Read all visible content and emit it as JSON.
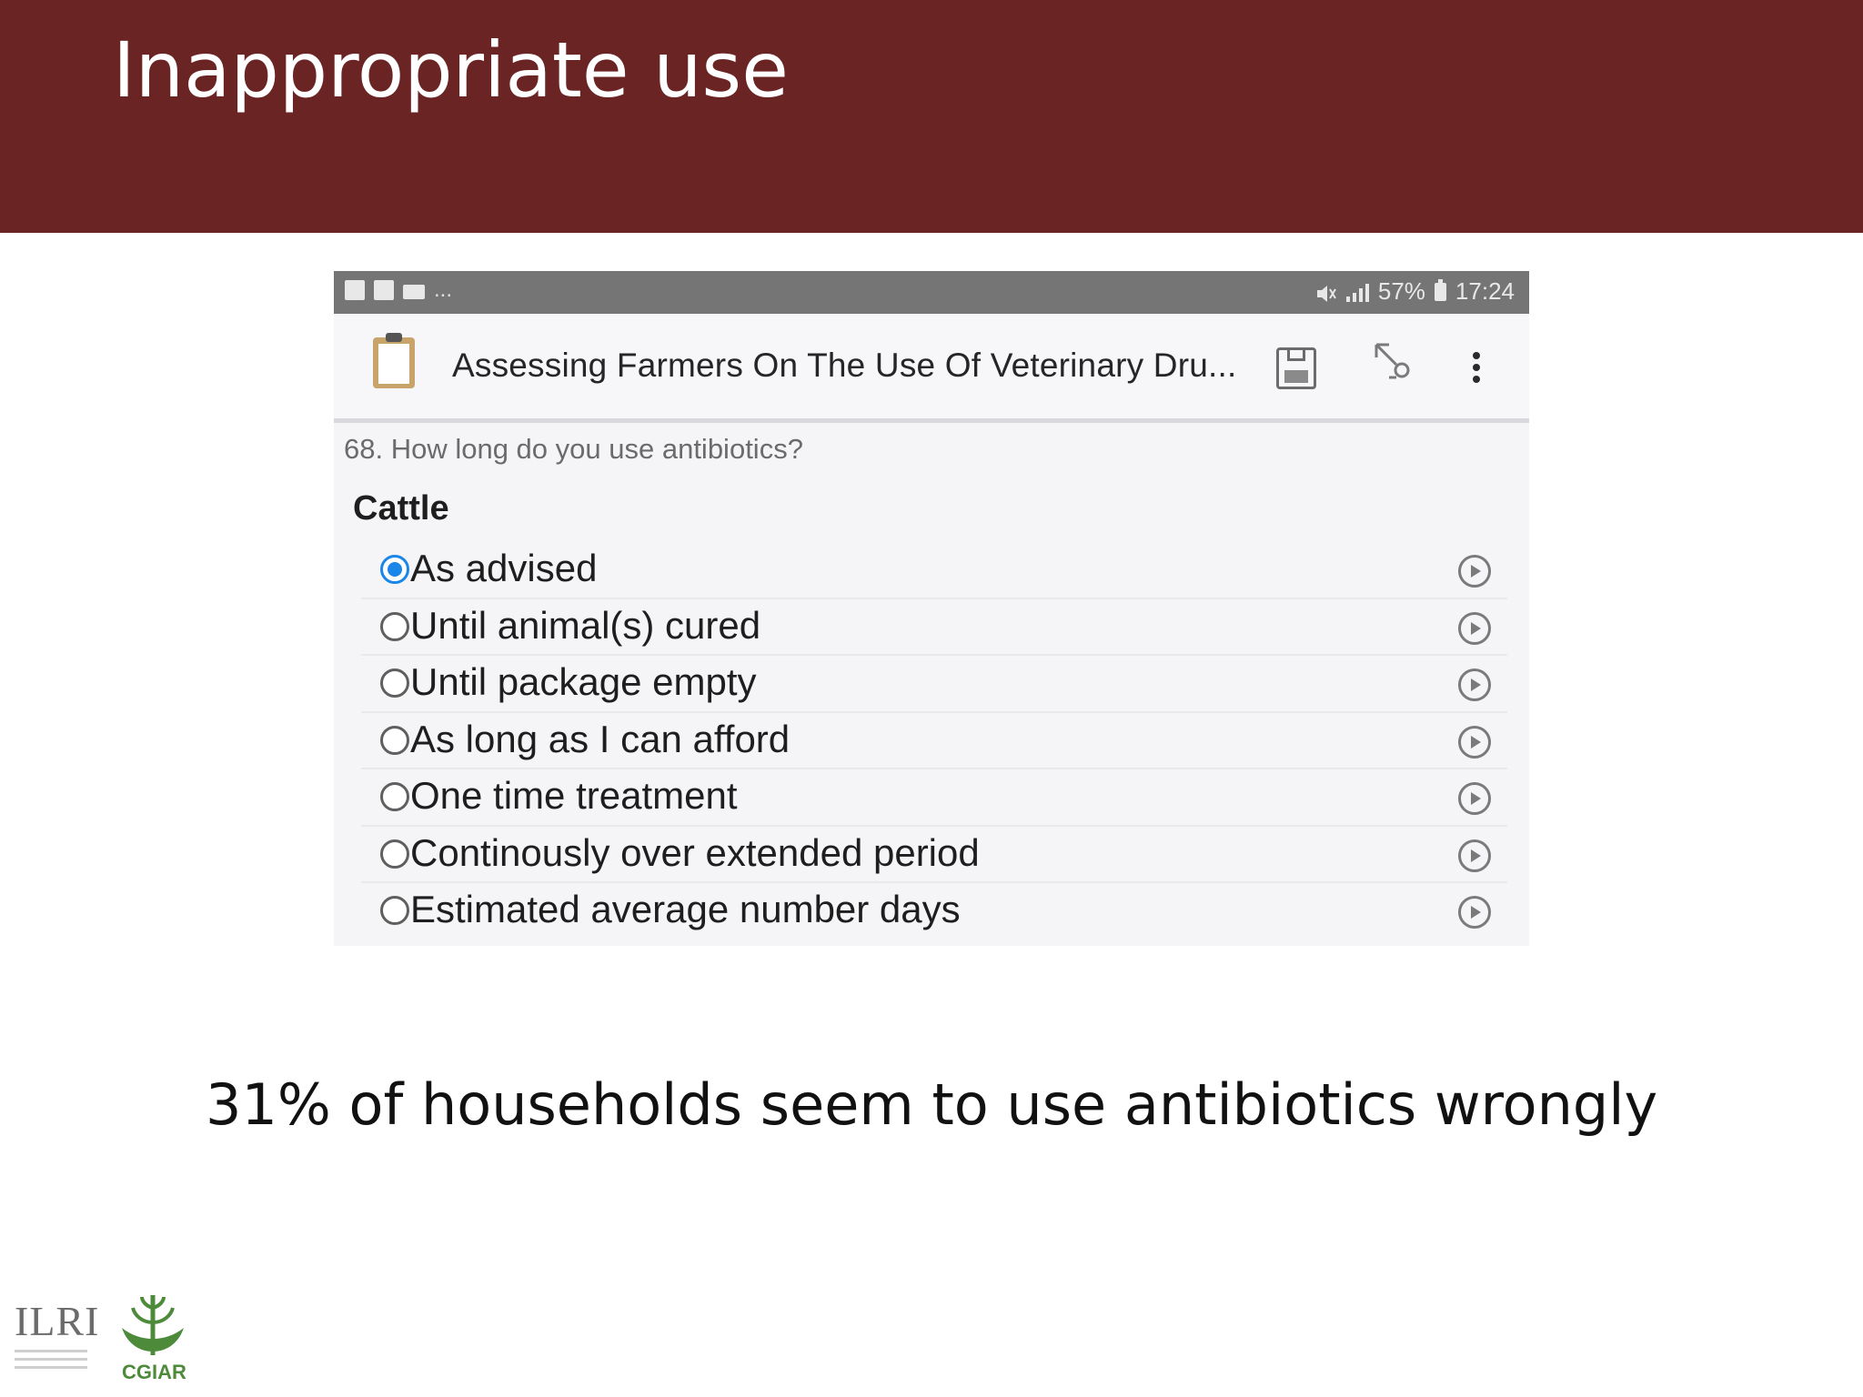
{
  "slide": {
    "title": "Inappropriate use",
    "caption": "31% of households seem to use antibiotics wrongly"
  },
  "statusbar": {
    "battery": "57%",
    "time": "17:24",
    "notification_dots": "..."
  },
  "app": {
    "title": "Assessing Farmers On The Use Of Veterinary Dru...",
    "icons": {
      "form": "clipboard-icon",
      "save": "save-icon",
      "navigate": "jump-icon",
      "menu": "overflow-menu-icon"
    }
  },
  "form": {
    "question": "68. How long do you use antibiotics?",
    "group_label": "Cattle",
    "options": [
      {
        "label": "As advised",
        "selected": true
      },
      {
        "label": "Until animal(s) cured",
        "selected": false
      },
      {
        "label": "Until package empty",
        "selected": false
      },
      {
        "label": "As long as I can afford",
        "selected": false
      },
      {
        "label": "One time treatment",
        "selected": false
      },
      {
        "label": "Continously over extended period",
        "selected": false
      },
      {
        "label": "Estimated average number days",
        "selected": false
      }
    ]
  },
  "logos": {
    "ilri": "ILRI",
    "cgiar": "CGIAR"
  },
  "colors": {
    "header": "#6a2424",
    "radio_selected": "#1a86e8"
  }
}
